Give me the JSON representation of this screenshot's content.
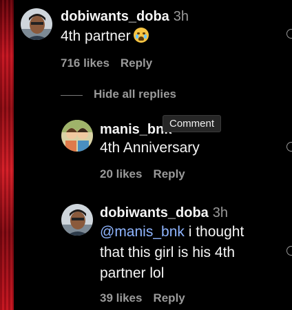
{
  "comments": [
    {
      "username": "dobiwants_doba",
      "time": "3h",
      "text": "4th partner",
      "emoji": "loudly-crying-face",
      "likes": "716 likes",
      "reply": "Reply"
    },
    {
      "username": "manis_bnk",
      "time": "",
      "text": "4th Anniversary",
      "likes": "20 likes",
      "reply": "Reply"
    },
    {
      "username": "dobiwants_doba",
      "time": "3h",
      "mention": "@manis_bnk",
      "text_line1_rest": " i thought",
      "text_line2": "that this girl is his 4th",
      "text_line3": "partner lol",
      "likes": "39 likes",
      "reply": "Reply"
    }
  ],
  "hide_replies": "Hide all replies",
  "tooltip": "Comment",
  "colors": {
    "background": "#000000",
    "text": "#f5f5f5",
    "muted": "#9a9a9a",
    "mention": "#8fb5ff",
    "accent_strip": "#c1121f"
  }
}
